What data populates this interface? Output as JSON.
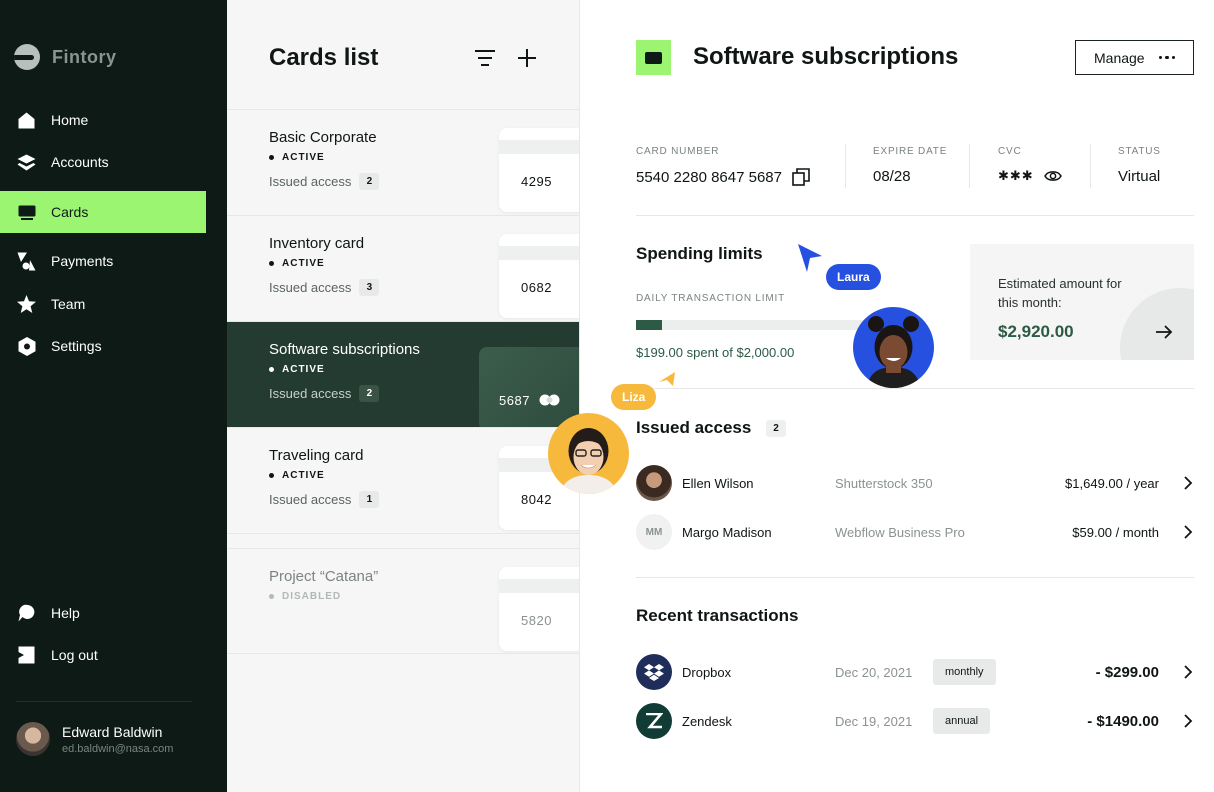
{
  "brand": {
    "name": "Fintory"
  },
  "nav": {
    "home": "Home",
    "accounts": "Accounts",
    "cards": "Cards",
    "payments": "Payments",
    "team": "Team",
    "settings": "Settings",
    "help": "Help",
    "logout": "Log out"
  },
  "user": {
    "name": "Edward Baldwin",
    "email": "ed.baldwin@nasa.com"
  },
  "cards_list": {
    "title": "Cards list",
    "access_label": "Issued access",
    "items": [
      {
        "name": "Basic Corporate",
        "status": "ACTIVE",
        "access_count": "2",
        "number": "4295"
      },
      {
        "name": "Inventory card",
        "status": "ACTIVE",
        "access_count": "3",
        "number": "0682"
      },
      {
        "name": "Software subscriptions",
        "status": "ACTIVE",
        "access_count": "2",
        "number": "5687"
      },
      {
        "name": "Traveling card",
        "status": "ACTIVE",
        "access_count": "1",
        "number": "8042"
      },
      {
        "name": "Project “Catana”",
        "status": "DISABLED",
        "number": "5820"
      }
    ]
  },
  "detail": {
    "title": "Software subscriptions",
    "manage_label": "Manage",
    "card_number_label": "CARD NUMBER",
    "card_number": "5540 2280 8647 5687",
    "expire_label": "EXPIRE DATE",
    "expire": "08/28",
    "cvc_label": "CVC",
    "cvc": "✱✱✱",
    "status_label": "STATUS",
    "status": "Virtual",
    "spending_title": "Spending limits",
    "limit_label": "DAILY TRANSACTION LIMIT",
    "limit_progress": 0.1,
    "spent_text": "$199.00 spent of $2,000.00",
    "estimate_label": "Estimated amount for this month:",
    "estimate_value": "$2,920.00",
    "issued_title": "Issued access",
    "issued_count": "2",
    "issued": [
      {
        "name": "Ellen Wilson",
        "service": "Shutterstock 350",
        "amount": "$1,649.00 / year"
      },
      {
        "initials": "MM",
        "name": "Margo Madison",
        "service": "Webflow Business Pro",
        "amount": "$59.00 / month"
      }
    ],
    "transactions_title": "Recent transactions",
    "transactions": [
      {
        "name": "Dropbox",
        "date": "Dec 20, 2021",
        "tag": "monthly",
        "amount": "- $299.00"
      },
      {
        "name": "Zendesk",
        "date": "Dec 19, 2021",
        "tag": "annual",
        "amount": "- $1490.00"
      }
    ]
  },
  "cursors": {
    "laura": "Laura",
    "liza": "Liza"
  },
  "colors": {
    "accent": "#9cf571",
    "sidebar": "#0d1a15",
    "dark_green": "#233b30",
    "laura": "#2651e0",
    "liza": "#f6b93b"
  }
}
